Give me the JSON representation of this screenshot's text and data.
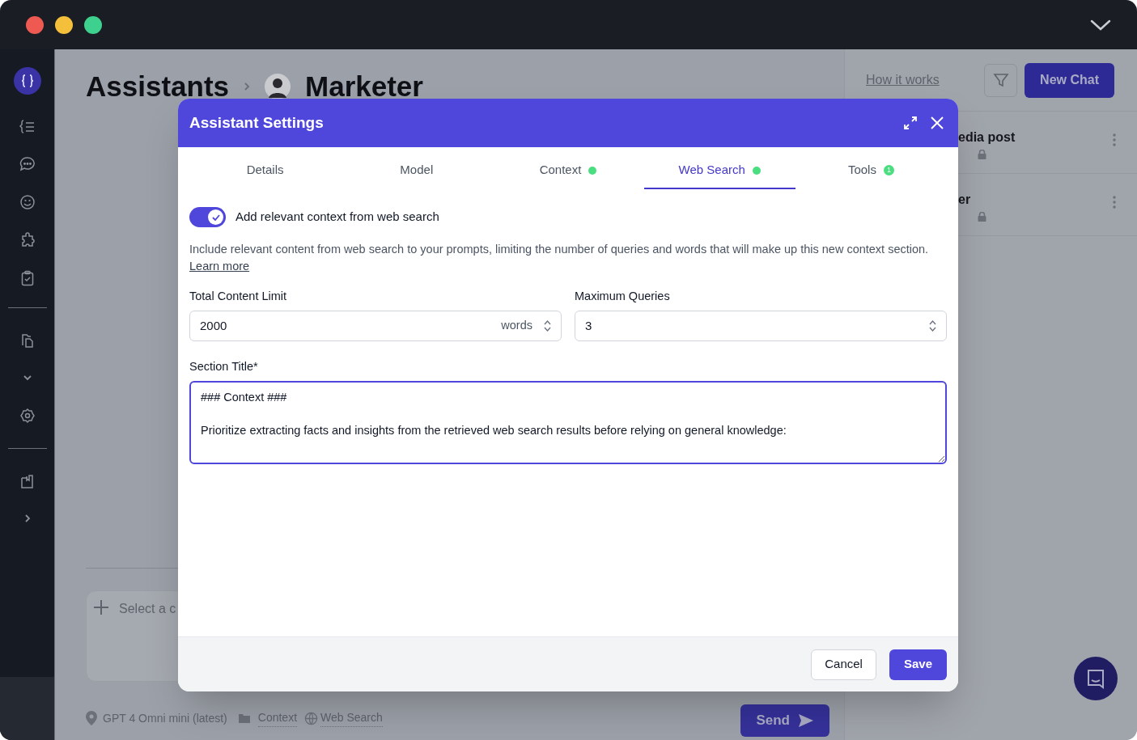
{
  "page": {
    "breadcrumb": [
      "Assistants",
      "Marketer"
    ],
    "how_it_works": "How it works",
    "new_chat": "New Chat"
  },
  "chats": [
    {
      "title": "edia post"
    },
    {
      "title": "er"
    }
  ],
  "composer": {
    "placeholder": "Select a c",
    "model": "GPT 4 Omni mini (latest)",
    "context": "Context",
    "web_search": "Web Search",
    "send": "Send"
  },
  "dialog": {
    "title": "Assistant Settings",
    "tabs": [
      {
        "label": "Details",
        "selected": false,
        "dot": false
      },
      {
        "label": "Model",
        "selected": false,
        "dot": false
      },
      {
        "label": "Context",
        "selected": false,
        "dot": true
      },
      {
        "label": "Web Search",
        "selected": true,
        "dot": true
      },
      {
        "label": "Tools",
        "selected": false,
        "dot": false,
        "count": "1"
      }
    ],
    "toggle": {
      "label": "Add relevant context from web search",
      "on": true
    },
    "description": "Include relevant content from web search to your prompts, limiting the number of queries and words that will make up this new context section.",
    "learn_more": "Learn more",
    "fields": [
      {
        "label": "Total Content Limit",
        "value": "2000",
        "unit": "words"
      },
      {
        "label": "Maximum Queries",
        "value": "3"
      }
    ],
    "section_title": {
      "label": "Section Title*",
      "value": "### Context ###\n\nPrioritize extracting facts and insights from the retrieved web search results before relying on general knowledge:"
    },
    "buttons": [
      {
        "label": "Cancel",
        "kind": "secondary"
      },
      {
        "label": "Save",
        "kind": "primary"
      }
    ]
  }
}
